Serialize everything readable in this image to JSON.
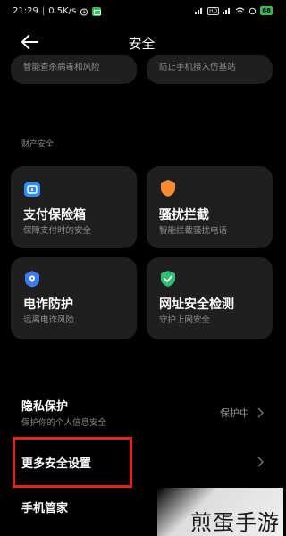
{
  "status_bar": {
    "time": "21:29",
    "speed": "0.5K/s",
    "hd_badge": "HD",
    "battery": "68"
  },
  "header": {
    "title": "安全",
    "back_icon": "back-arrow-icon"
  },
  "top_cards": [
    {
      "subtitle": "智能查杀病毒和风险"
    },
    {
      "subtitle": "防止手机接入仿基站"
    }
  ],
  "section": {
    "label": "财产安全"
  },
  "feature_cards": [
    {
      "title": "支付保险箱",
      "subtitle": "保障支付时的安全",
      "icon": "safe-box-icon",
      "color": "#2f8ef5"
    },
    {
      "title": "骚扰拦截",
      "subtitle": "智能拦截骚扰电话",
      "icon": "shield-icon",
      "color": "#f58a2f"
    },
    {
      "title": "电诈防护",
      "subtitle": "远离电诈风险",
      "icon": "phone-shield-icon",
      "color": "#3c7cf0"
    },
    {
      "title": "网址安全检测",
      "subtitle": "守护上网安全",
      "icon": "check-shield-icon",
      "color": "#2fbe73"
    }
  ],
  "list": {
    "privacy": {
      "title": "隐私保护",
      "subtitle": "保护你的个人信息安全",
      "value": "保护中"
    },
    "more_security": {
      "title": "更多安全设置"
    },
    "phone_manager": {
      "title": "手机管家"
    }
  },
  "watermark": {
    "text": "煎蛋手游"
  }
}
